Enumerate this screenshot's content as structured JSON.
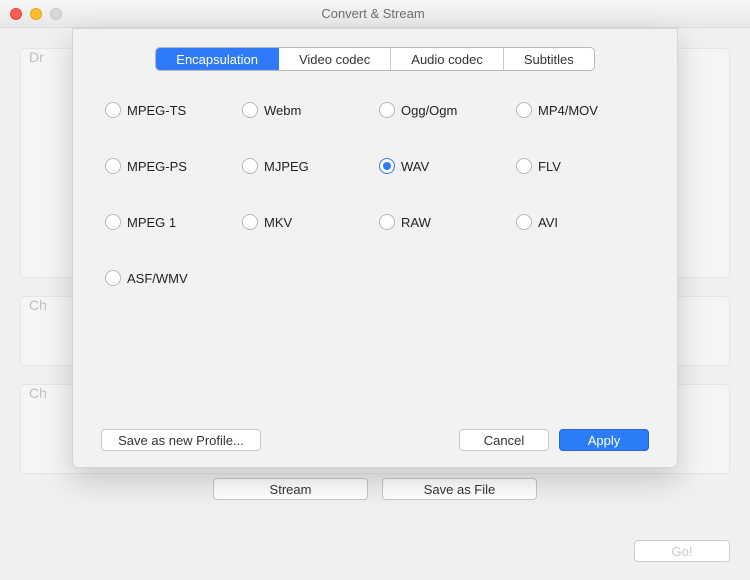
{
  "titlebar": {
    "title": "Convert & Stream"
  },
  "tabs": [
    {
      "label": "Encapsulation",
      "active": true
    },
    {
      "label": "Video codec",
      "active": false
    },
    {
      "label": "Audio codec",
      "active": false
    },
    {
      "label": "Subtitles",
      "active": false
    }
  ],
  "encapsulation_options": [
    {
      "label": "MPEG-TS",
      "selected": false
    },
    {
      "label": "Webm",
      "selected": false
    },
    {
      "label": "Ogg/Ogm",
      "selected": false
    },
    {
      "label": "MP4/MOV",
      "selected": false
    },
    {
      "label": "MPEG-PS",
      "selected": false
    },
    {
      "label": "MJPEG",
      "selected": false
    },
    {
      "label": "WAV",
      "selected": true
    },
    {
      "label": "FLV",
      "selected": false
    },
    {
      "label": "MPEG 1",
      "selected": false
    },
    {
      "label": "MKV",
      "selected": false
    },
    {
      "label": "RAW",
      "selected": false
    },
    {
      "label": "AVI",
      "selected": false
    },
    {
      "label": "ASF/WMV",
      "selected": false
    }
  ],
  "buttons": {
    "save_profile": "Save as new Profile...",
    "cancel": "Cancel",
    "apply": "Apply",
    "stream": "Stream",
    "save_as_file": "Save as File",
    "go": "Go!"
  },
  "bg_labels": {
    "s1": "Dr",
    "s2": "Ch",
    "s3": "Ch"
  }
}
